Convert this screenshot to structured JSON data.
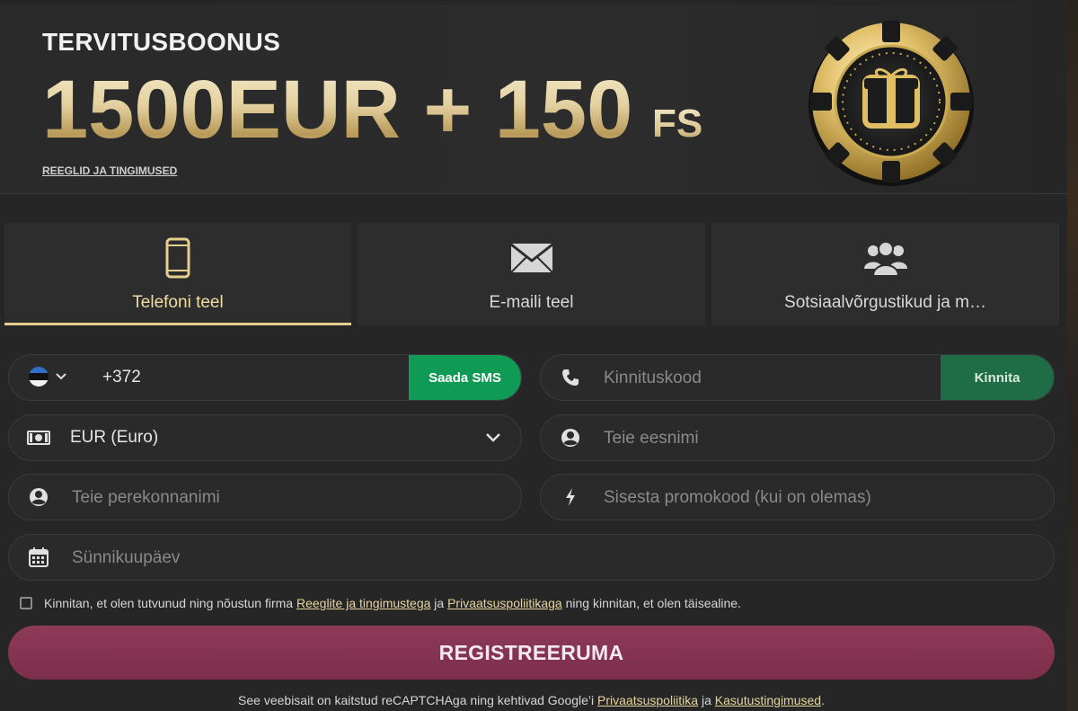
{
  "banner": {
    "label": "TERVITUSBOONUS",
    "amount": "1500EUR + 150",
    "suffix": "FS",
    "terms_link": "REEGLID JA TINGIMUSED"
  },
  "tabs": [
    {
      "label": "Telefoni teel",
      "icon": "smartphone-icon",
      "active": true
    },
    {
      "label": "E-maili teel",
      "icon": "envelope-icon",
      "active": false
    },
    {
      "label": "Sotsiaalvõrgustikud ja m…",
      "icon": "users-icon",
      "active": false
    }
  ],
  "form": {
    "phone": {
      "country_flag": "estonia-flag-icon",
      "prefix": "+372",
      "send_sms_label": "Saada SMS"
    },
    "code": {
      "placeholder": "Kinnituskood",
      "confirm_label": "Kinnita"
    },
    "currency": {
      "value": "EUR (Euro)"
    },
    "first_name": {
      "placeholder": "Teie eesnimi"
    },
    "last_name": {
      "placeholder": "Teie perekonnanimi"
    },
    "promo": {
      "placeholder": "Sisesta promokood (kui on olemas)"
    },
    "birthdate": {
      "placeholder": "Sünnikuupäev"
    }
  },
  "consent": {
    "text_before": "Kinnitan, et olen tutvunud ning nõustun firma",
    "terms_link": "Reeglite ja tingimustega",
    "text_mid": "ja",
    "privacy_link": "Privaatsuspoliitikaga",
    "text_after": "ning kinnitan, et olen täisealine.",
    "checked": false
  },
  "register_label": "REGISTREERUMA",
  "footer": {
    "text_before": "See veebisait on kaitstud reCAPTCHAga ning kehtivad Google’i",
    "privacy_link": "Privaatsuspoliitika",
    "text_mid": "ja",
    "terms_link": "Kasutustingimused",
    "text_after": "."
  },
  "colors": {
    "gold": "#e6cf8e",
    "green": "#0f9b55",
    "dark_green": "#1f6d46",
    "register": "#8a3655"
  }
}
